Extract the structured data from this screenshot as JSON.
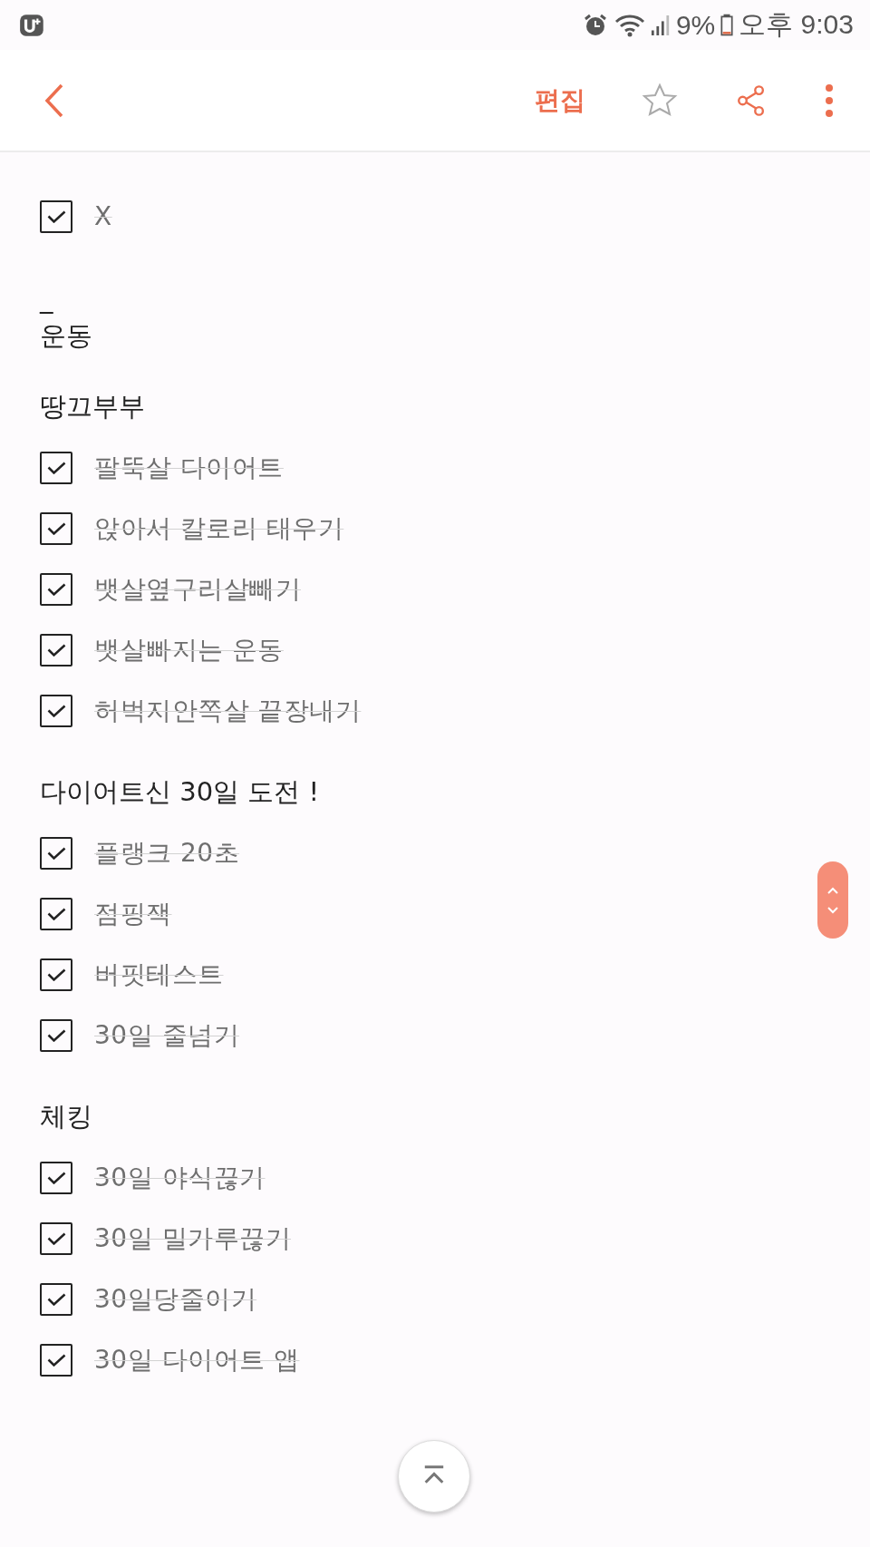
{
  "status_bar": {
    "battery": "9%",
    "time": "오후 9:03"
  },
  "header": {
    "edit": "편집"
  },
  "note": {
    "sections": [
      {
        "lines": [
          {
            "kind": "check",
            "text": "X",
            "checked": true
          }
        ]
      },
      {
        "lines": [
          {
            "kind": "text",
            "text": "_"
          },
          {
            "kind": "text",
            "text": "운동"
          }
        ]
      },
      {
        "lines": [
          {
            "kind": "text",
            "text": "땅끄부부"
          },
          {
            "kind": "check",
            "text": "팔뚝살 다이어트",
            "checked": true
          },
          {
            "kind": "check",
            "text": "앉아서 칼로리 태우기",
            "checked": true
          },
          {
            "kind": "check",
            "text": "뱃살옆구리살빼기",
            "checked": true
          },
          {
            "kind": "check",
            "text": "뱃살빠지는 운동",
            "checked": true
          },
          {
            "kind": "check",
            "text": "허벅지안쪽살 끝장내기",
            "checked": true
          }
        ]
      },
      {
        "lines": [
          {
            "kind": "text",
            "text": "다이어트신 30일 도전 !"
          },
          {
            "kind": "check",
            "text": "플랭크 20초",
            "checked": true
          },
          {
            "kind": "check",
            "text": "점핑잭",
            "checked": true
          },
          {
            "kind": "check",
            "text": "버핏테스트",
            "checked": true
          },
          {
            "kind": "check",
            "text": "30일 줄넘기",
            "checked": true
          }
        ]
      },
      {
        "lines": [
          {
            "kind": "text",
            "text": "체킹"
          },
          {
            "kind": "check",
            "text": "30일 야식끊기",
            "checked": true
          },
          {
            "kind": "check",
            "text": "30일 밀가루끊기",
            "checked": true
          },
          {
            "kind": "check",
            "text": "30일당줄이기",
            "checked": true
          },
          {
            "kind": "check",
            "text": "30일 다이어트 앱",
            "checked": true
          }
        ]
      }
    ]
  }
}
